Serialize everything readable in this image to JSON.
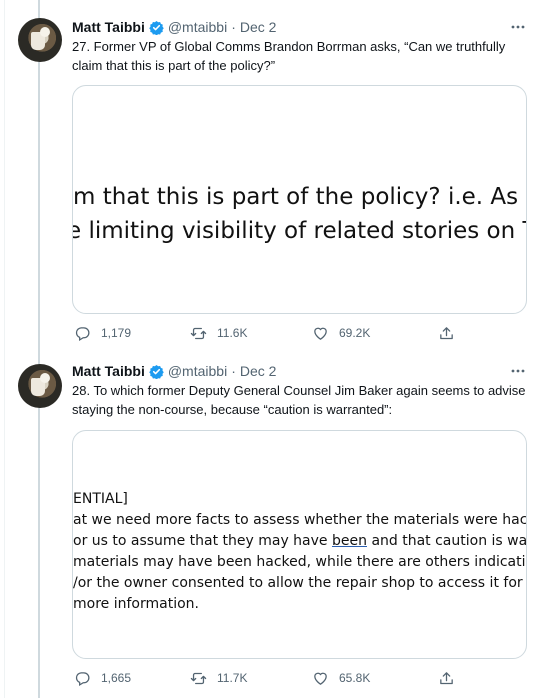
{
  "tweets": [
    {
      "author_name": "Matt Taibbi",
      "handle": "@mtaibbi",
      "separator": "·",
      "date": "Dec 2",
      "text": "27. Former VP of Global Comms Brandon Borrman asks, “Can we truthfully claim that this is part of the policy?”",
      "media_lines": [
        "m that this is part of the policy? i.e. As pa",
        "limiting visibility of related stories on Tw"
      ],
      "media_prefix_2": "e",
      "replies": "1,179",
      "retweets": "11.6K",
      "likes": "69.2K"
    },
    {
      "author_name": "Matt Taibbi",
      "handle": "@mtaibbi",
      "separator": "·",
      "date": "Dec 2",
      "text": "28. To which former Deputy General Counsel Jim Baker again seems to advise staying the non-course, because “caution is warranted”:",
      "media_lines": [
        "ENTIAL]",
        "at we need more facts to assess whether the materials were hack",
        "or us to assume that they may have",
        "been",
        "and that caution is warr",
        "materials may have been hacked, while there are others indicati",
        "/or the owner consented to allow the repair shop to access it for",
        "more information."
      ],
      "replies": "1,665",
      "retweets": "11.7K",
      "likes": "65.8K"
    }
  ],
  "icons": {
    "more": "more-icon",
    "verified": "verified-badge-icon",
    "reply": "reply-icon",
    "retweet": "retweet-icon",
    "like": "like-icon",
    "share": "share-icon"
  },
  "colors": {
    "verified": "#1d9bf0",
    "muted": "#536471",
    "border": "#cfd9de"
  }
}
